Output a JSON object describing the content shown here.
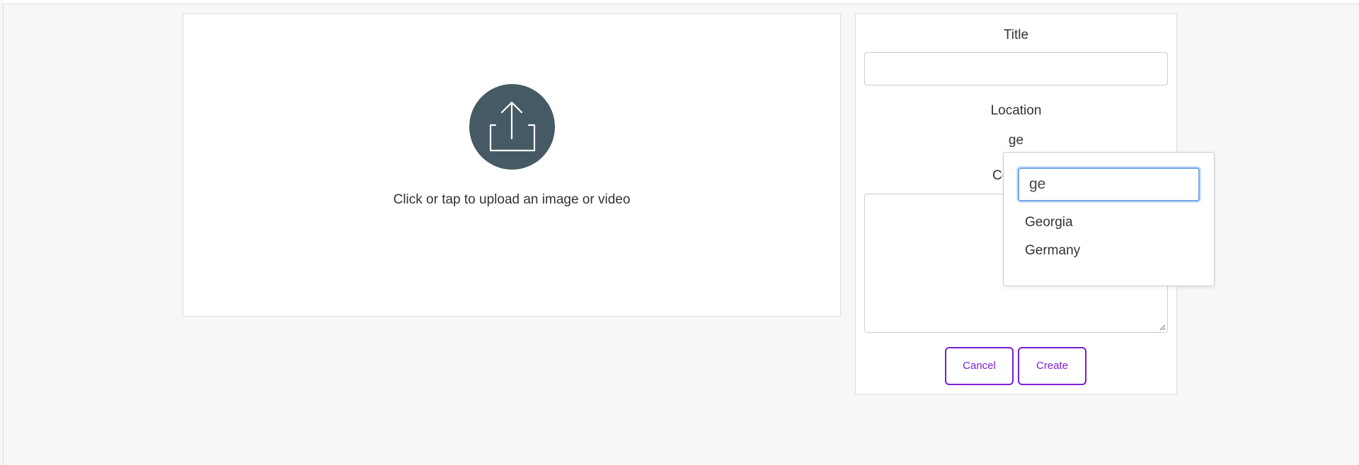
{
  "upload": {
    "icon": "upload-icon",
    "prompt": "Click or tap to upload an image or video"
  },
  "form": {
    "title_label": "Title",
    "title_value": "",
    "location_label": "Location",
    "location_value": "ge",
    "content_label_partial": "Co",
    "cancel_label": "Cancel",
    "create_label": "Create"
  },
  "dropdown": {
    "search_value": "ge",
    "options": [
      "Georgia",
      "Germany"
    ]
  },
  "colors": {
    "accent": "#7a1fd6",
    "upload_circle": "#455a64",
    "focus_ring": "#74a9e6"
  }
}
